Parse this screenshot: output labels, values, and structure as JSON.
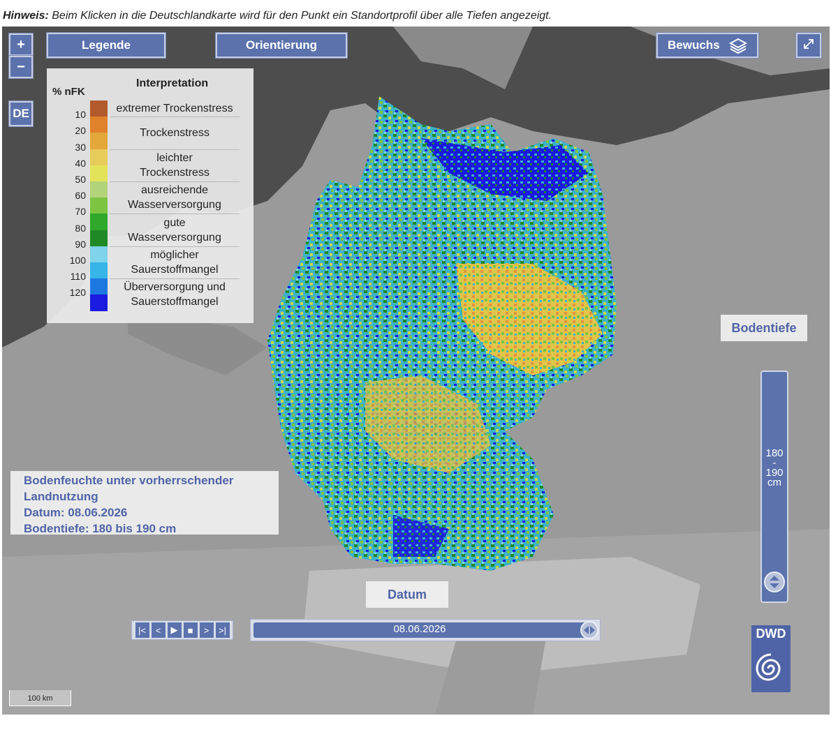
{
  "hint": {
    "label": "Hinweis:",
    "text": " Beim Klicken in die Deutschlandkarte wird für den Punkt ein Standortprofil über alle Tiefen angezeigt."
  },
  "controls": {
    "zoom_in": "+",
    "zoom_out": "−",
    "region": "DE",
    "legend_button": "Legende",
    "orientation_button": "Orientierung",
    "layer_button": "Bewuchs",
    "fullscreen_icon": "expand-icon"
  },
  "legend": {
    "unit_header": "% nFK",
    "interp_header": "Interpretation",
    "ticks": [
      "10",
      "20",
      "30",
      "40",
      "50",
      "60",
      "70",
      "80",
      "90",
      "100",
      "110",
      "120"
    ],
    "colors": [
      "#b35a2c",
      "#e0822a",
      "#e3a73a",
      "#e8cc5a",
      "#e3e35a",
      "#b3d37a",
      "#7cc442",
      "#2fa82b",
      "#1f8a25",
      "#7fd3ea",
      "#37b4e8",
      "#1c78e0",
      "#1a1ae0"
    ],
    "classes": [
      {
        "label": "extremer Trockenstress"
      },
      {
        "label": "Trockenstress"
      },
      {
        "label": "leichter\nTrockenstress"
      },
      {
        "label": "ausreichende\nWasserversorgung"
      },
      {
        "label": "gute\nWasserversorgung"
      },
      {
        "label": "möglicher\nSauerstoffmangel"
      },
      {
        "label": "Überversorgung und\nSauerstoffmangel"
      }
    ]
  },
  "info": {
    "line1": "Bodenfeuchte unter vorherrschender",
    "line2": "Landnutzung",
    "line3": "Datum: 08.06.2026",
    "line4": "Bodentiefe: 180 bis 190 cm"
  },
  "depth": {
    "title": "Bodentiefe",
    "value_top": "180",
    "value_sep": "-",
    "value_mid": "190",
    "value_unit": "cm"
  },
  "date": {
    "title": "Datum",
    "value": "08.06.2026"
  },
  "player": {
    "first": "first-icon",
    "prev": "prev-icon",
    "play": "play-icon",
    "stop": "stop-icon",
    "next": "next-icon",
    "last": "last-icon"
  },
  "logo": {
    "text": "DWD"
  },
  "scale": {
    "label": "100 km"
  }
}
